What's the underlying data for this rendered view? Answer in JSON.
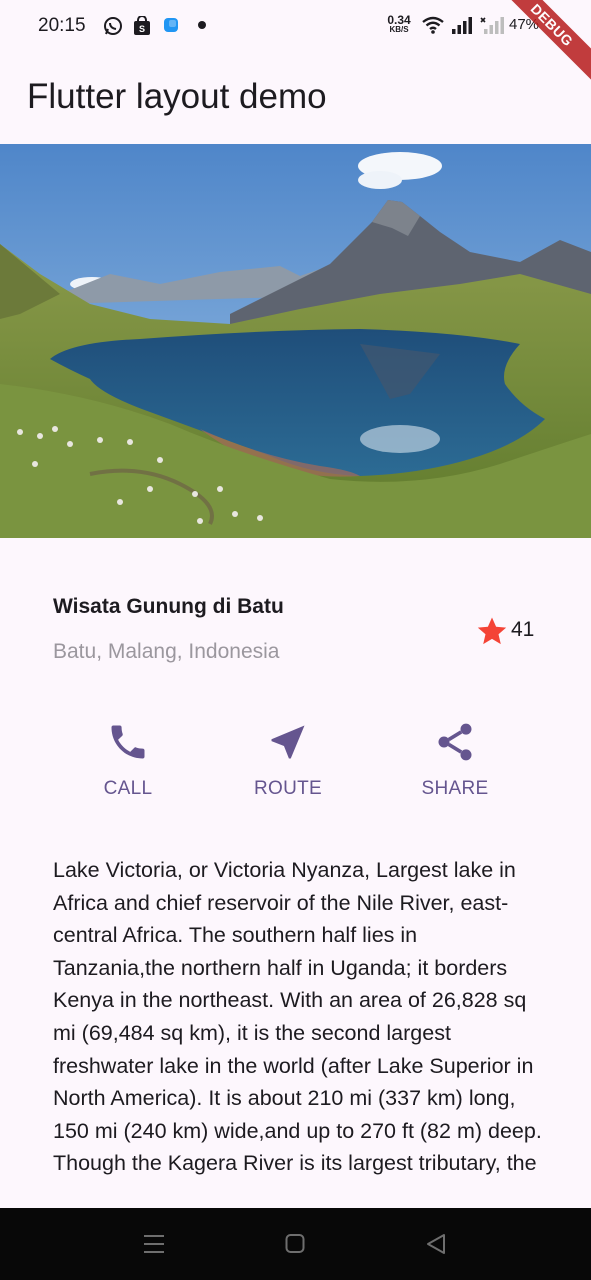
{
  "status_bar": {
    "time": "20:15",
    "net_speed_value": "0.34",
    "net_speed_unit": "KB/S",
    "battery": "47%",
    "icons": [
      "whatsapp-icon",
      "shopping-bag-icon",
      "app-icon",
      "notification-dot",
      "wifi-icon",
      "signal-icon",
      "signal-x-icon",
      "battery-icon"
    ]
  },
  "debug_banner": "DEBUG",
  "app_bar": {
    "title": "Flutter layout demo"
  },
  "hero_image": {
    "subject": "mountain-lake-landscape"
  },
  "title_section": {
    "name": "Wisata Gunung di Batu",
    "location": "Batu, Malang, Indonesia",
    "star_count": "41",
    "star_color": "#f44336"
  },
  "actions": [
    {
      "label": "CALL",
      "icon": "phone-icon"
    },
    {
      "label": "ROUTE",
      "icon": "near-me-icon"
    },
    {
      "label": "SHARE",
      "icon": "share-icon"
    }
  ],
  "accent_color": "#65558f",
  "description": "Lake Victoria, or Victoria Nyanza, Largest lake in Africa and chief reservoir of the Nile River, east-central Africa. The southern half lies in Tanzania,the northern half in Uganda; it borders Kenya in the northeast. With an area of 26,828 sq mi (69,484 sq km), it is the second largest freshwater lake in the world (after Lake Superior in North America). It is about 210 mi (337 km) long, 150 mi (240 km) wide,and up to 270 ft (82 m) deep. Though the Kagera River is its largest tributary, the",
  "nav_bar": {
    "buttons": [
      "menu-icon",
      "home-icon",
      "back-icon"
    ]
  }
}
